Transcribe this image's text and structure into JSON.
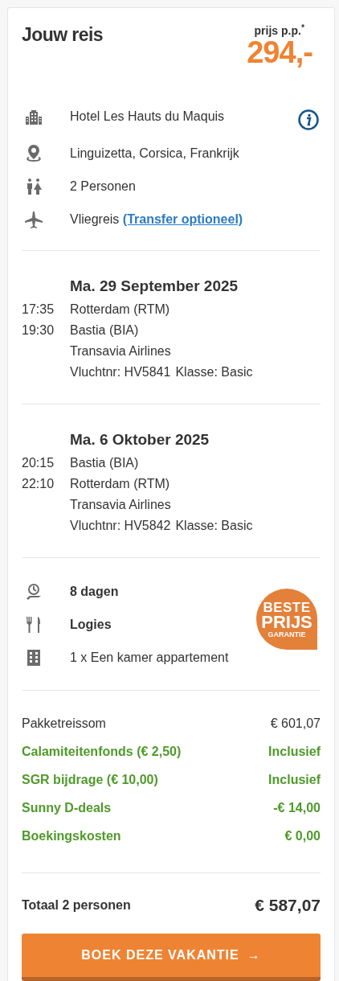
{
  "title": "Jouw reis",
  "price": {
    "label": "prijs p.p.$^{*}$",
    "amount": "294,-"
  },
  "info": [
    {
      "text": "Hotel Les Hauts du Maquis"
    },
    {
      "text": "Linguizetta, Corsica, Frankrijk"
    },
    {
      "text": "2 Personen"
    },
    {
      "text": "Vliegreis",
      "link": "(Transfer optioneel)"
    }
  ],
  "flights": [
    {
      "date": "Ma. 29 September 2025",
      "rows": [
        {
          "time": "17:35",
          "text": "Rotterdam (RTM)"
        },
        {
          "time": "19:30",
          "text": "Bastia (BIA)"
        },
        {
          "text": "Transavia Airlines"
        }
      ],
      "flight_number": "Vluchtnr: HV5841",
      "class": "Klasse: Basic"
    },
    {
      "date": "Ma. 6 Oktober 2025",
      "rows": [
        {
          "time": "20:15",
          "text": "Bastia (BIA)"
        },
        {
          "time": "22:10",
          "text": "Rotterdam (RTM)"
        },
        {
          "text": "Transavia Airlines"
        }
      ],
      "flight_number": "Vluchtnr: HV5842",
      "class": "Klasse: Basic"
    }
  ],
  "details": [
    {
      "text": "8 dagen",
      "bold": true
    },
    {
      "text": "Logies",
      "bold": true
    },
    {
      "text": "1 x Een kamer appartement",
      "bold": false
    }
  ],
  "badge": [
    "BESTE",
    "PRIJS",
    "GARANTIE"
  ],
  "costs": [
    {
      "kind": "normal",
      "label": "Pakketreissom",
      "value": "€ 601,07"
    },
    {
      "kind": "included",
      "label": "Calamiteitenfonds (€ 2,50)",
      "value": "Inclusief"
    },
    {
      "kind": "included",
      "label": "SGR bijdrage (€ 10,00)",
      "value": "Inclusief"
    },
    {
      "kind": "included",
      "label": "Sunny D-deals",
      "value": "-€ 14,00"
    },
    {
      "kind": "included",
      "label": "Boekingskosten",
      "value": "€ 0,00"
    }
  ],
  "total": {
    "label": "Totaal 2 personen",
    "value": "€ 587,07"
  },
  "button": {
    "label": "BOEK DEZE VAKANTIE",
    "arrow": "→"
  }
}
